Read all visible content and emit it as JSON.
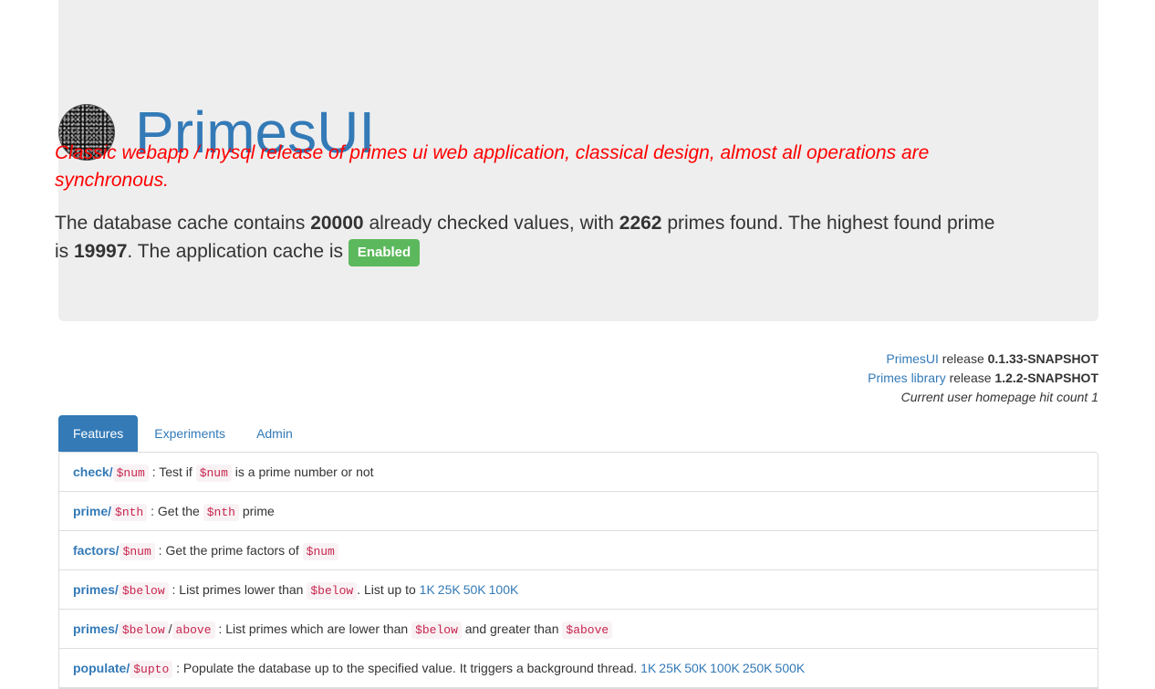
{
  "header": {
    "title": "PrimesUI",
    "subtitle": "Classic webapp / mysql release of primes ui web application, classical design, almost all operations are synchronous.",
    "stats": {
      "p1": "The database cache contains ",
      "checked": "20000",
      "p2": " already checked values, with ",
      "primes": "2262",
      "p3": " primes found. The highest found prime is ",
      "highest": "19997",
      "p4": ". The application cache is ",
      "cache_status": "Enabled"
    }
  },
  "release": {
    "app_link": "PrimesUI",
    "app_text": " release ",
    "app_version": "0.1.33-SNAPSHOT",
    "lib_link": "Primes library",
    "lib_text": " release ",
    "lib_version": "1.2.2-SNAPSHOT",
    "hit_count": "Current user homepage hit count 1"
  },
  "tabs": [
    "Features",
    "Experiments",
    "Admin"
  ],
  "features": {
    "check": {
      "cmd": "check/",
      "arg": "$num",
      "t1": " : Test if ",
      "arg2": "$num",
      "t2": " is a prime number or not"
    },
    "prime": {
      "cmd": "prime/",
      "arg": "$nth",
      "t1": " : Get the ",
      "arg2": "$nth",
      "t2": " prime"
    },
    "factors": {
      "cmd": "factors/",
      "arg": "$num",
      "t1": " : Get the prime factors of ",
      "arg2": "$num"
    },
    "primes": {
      "cmd": "primes/",
      "arg": "$below",
      "t1": " : List primes lower than ",
      "arg2": "$below",
      "t2": ". List up to ",
      "links": [
        "1K",
        "25K",
        "50K",
        "100K"
      ]
    },
    "primes_range": {
      "cmd": "primes/",
      "arg": "$below",
      "sep": "/",
      "arg_b": "above",
      "t1": " : List primes which are lower than ",
      "arg2": "$below",
      "t2": " and greater than ",
      "arg3": "$above"
    },
    "populate": {
      "cmd": "populate/",
      "arg": "$upto",
      "t1": " : Populate the database up to the specified value. It triggers a background thread. ",
      "links": [
        "1K",
        "25K",
        "50K",
        "100K",
        "250K",
        "500K"
      ]
    }
  },
  "colors": {
    "accent": "#337ab7",
    "subtitle": "#ff0000",
    "badge": "#5cb85c",
    "code": "#c7254e"
  }
}
